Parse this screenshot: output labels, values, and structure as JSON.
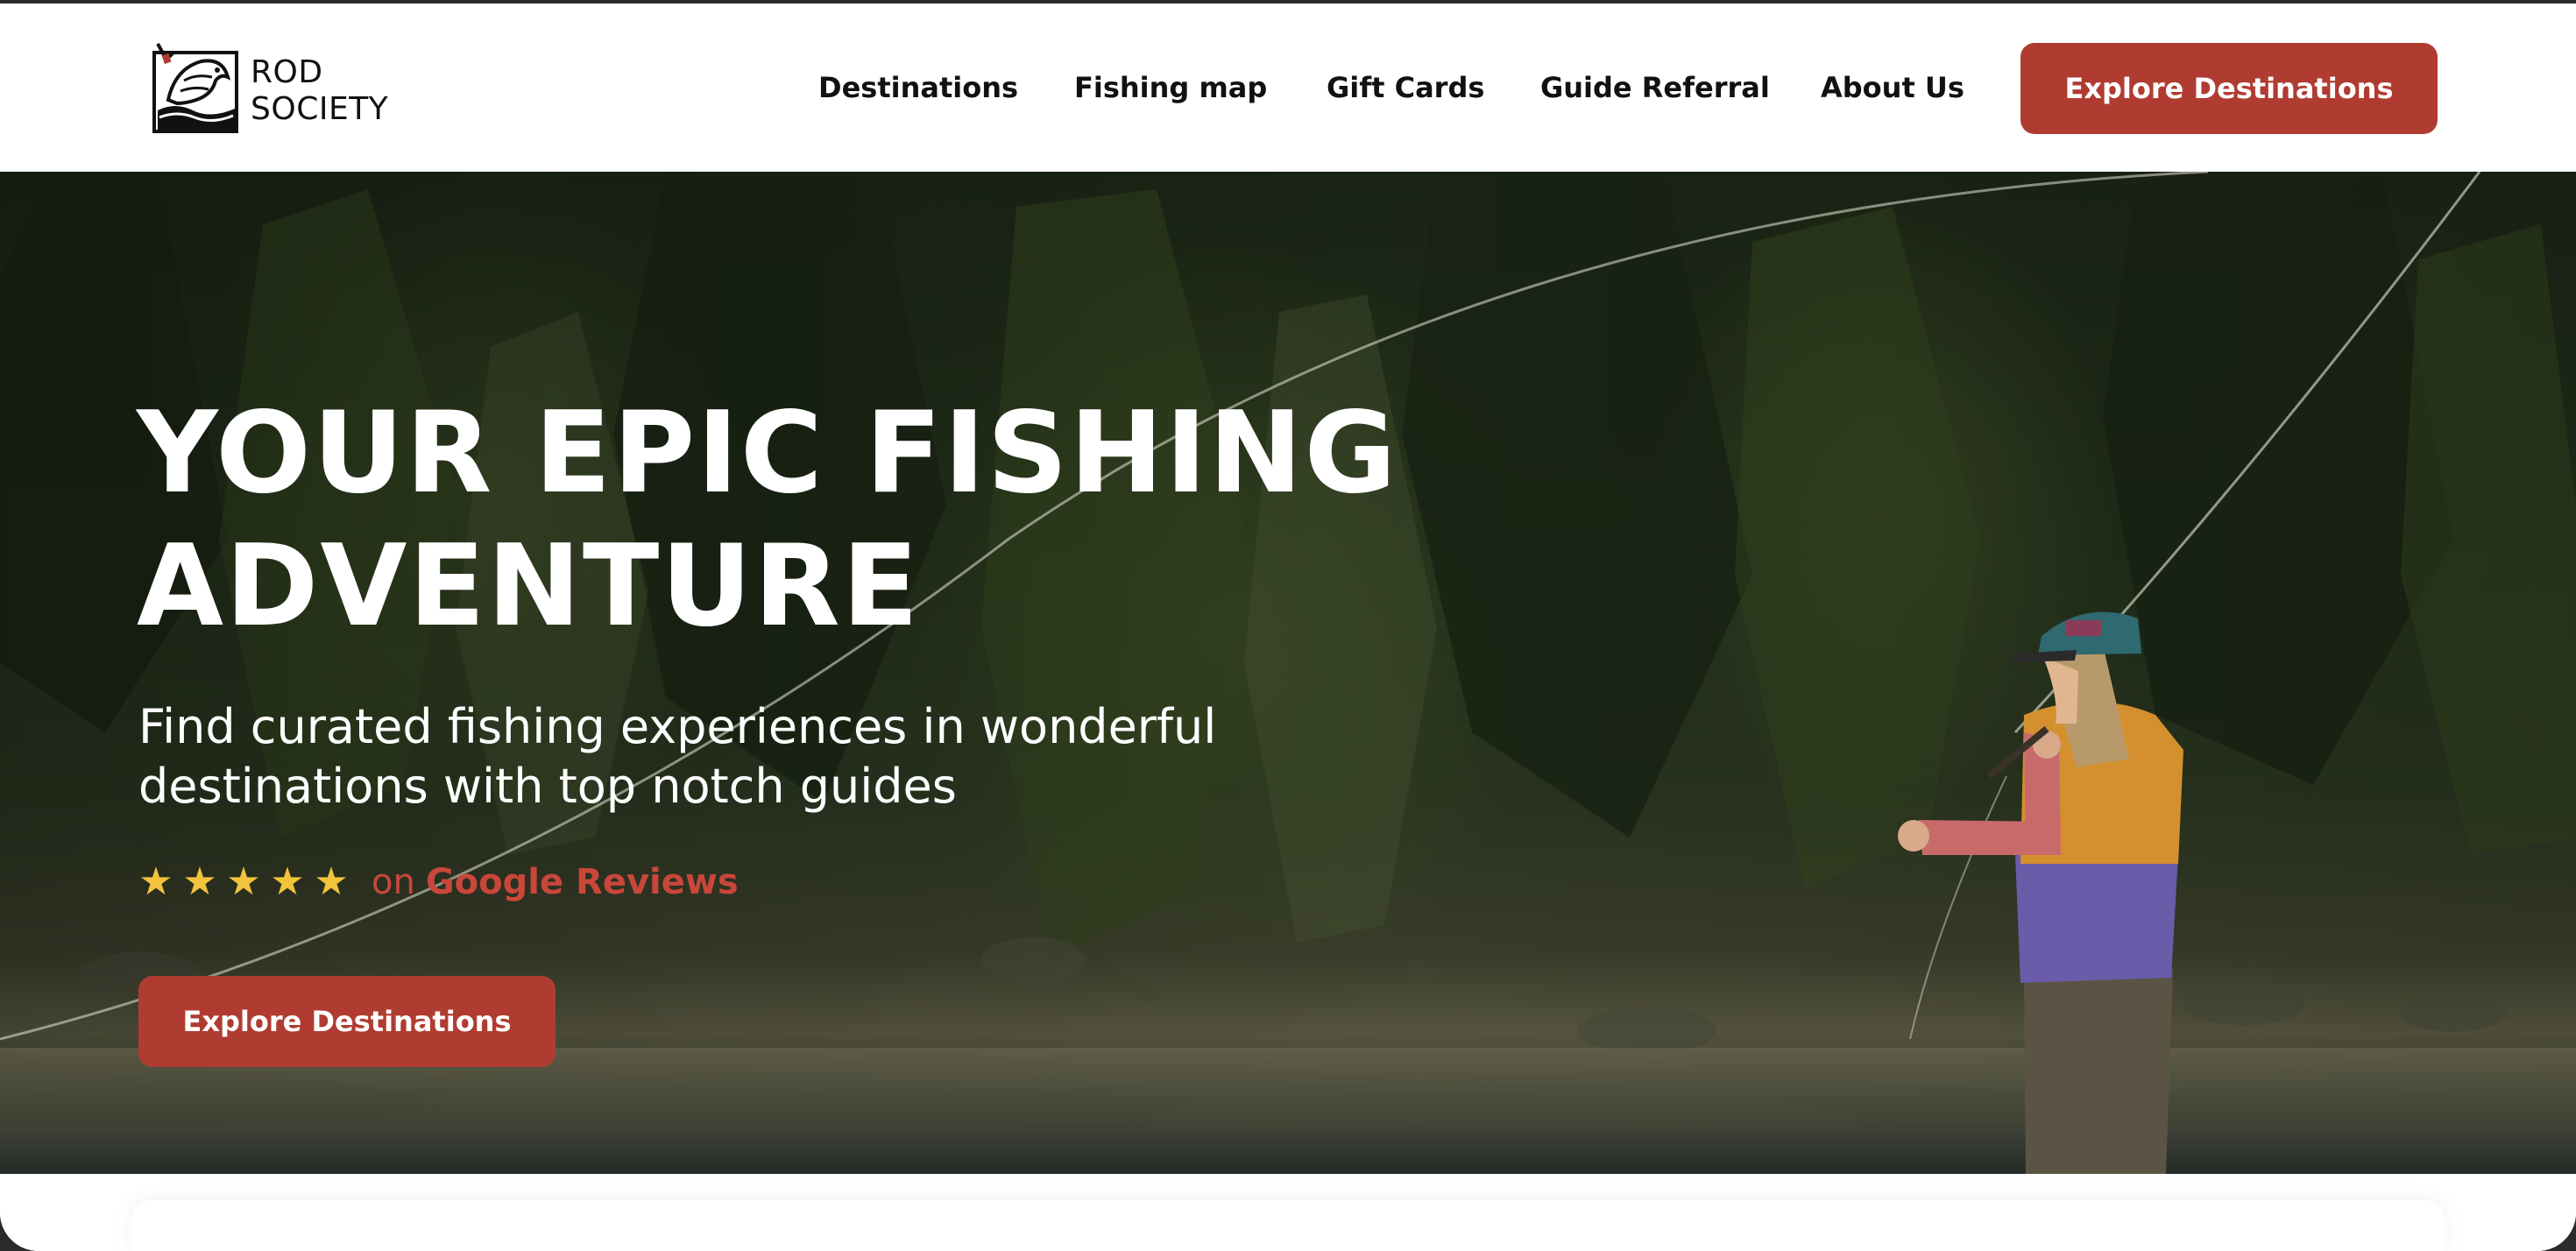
{
  "brand": {
    "line1": "ROD",
    "line2": "SOCIETY",
    "logo_icon": "leaping-fish-icon"
  },
  "nav": {
    "items": [
      {
        "label": "Destinations"
      },
      {
        "label": "Fishing map"
      },
      {
        "label": "Gift Cards"
      },
      {
        "label": "Guide Referral"
      },
      {
        "label": "About Us"
      }
    ],
    "cta_label": "Explore Destinations"
  },
  "hero": {
    "title_line1": "YOUR EPIC FISHING",
    "title_line2": "ADVENTURE",
    "subtitle_line1": "Find curated fishing experiences in wonderful",
    "subtitle_line2": "destinations with top notch guides",
    "rating": {
      "stars": 5,
      "star_icon": "star-icon",
      "on_text": "on",
      "source_label": "Google Reviews"
    },
    "cta_label": "Explore Destinations"
  },
  "colors": {
    "accent": "#b03c31",
    "rating_text": "#c9473a",
    "star": "#f2c33c",
    "nav_text": "#111111"
  }
}
